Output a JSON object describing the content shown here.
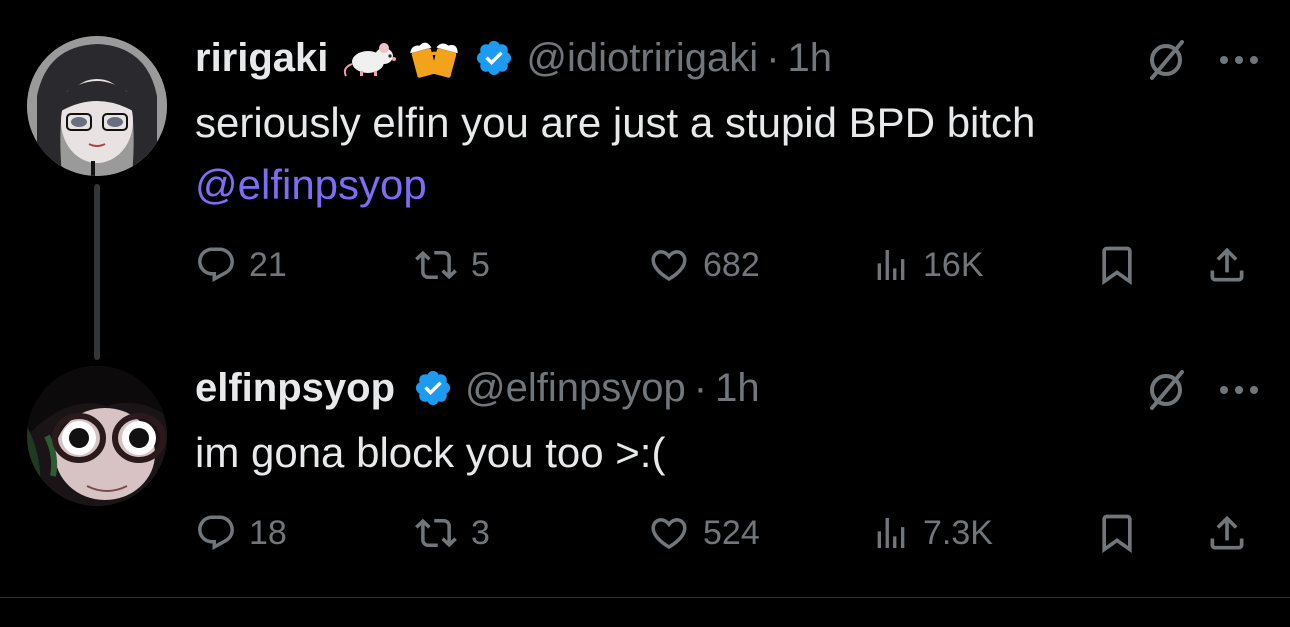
{
  "tweets": [
    {
      "display_name": "ririgaki",
      "emojis": [
        "rat-emoji",
        "beer-mugs-emoji"
      ],
      "verified": true,
      "handle": "@idiotririgaki",
      "separator": "·",
      "time": "1h",
      "text": "seriously elfin you are just a stupid BPD bitch",
      "mention": "@elfinpsyop",
      "replies": "21",
      "retweets": "5",
      "likes": "682",
      "views": "16K"
    },
    {
      "display_name": "elfinpsyop",
      "verified": true,
      "handle": "@elfinpsyop",
      "separator": "·",
      "time": "1h",
      "text": "im gona block you too >:(",
      "replies": "18",
      "retweets": "3",
      "likes": "524",
      "views": "7.3K"
    }
  ],
  "colors": {
    "background": "#000000",
    "text": "#e7e9ea",
    "muted": "#71767b",
    "mention": "#7f6cf4",
    "verified": "#1d9bf0",
    "thread_line": "#333639"
  },
  "icons": [
    "reply-icon",
    "retweet-icon",
    "like-icon",
    "views-icon",
    "bookmark-icon",
    "share-icon",
    "grok-icon",
    "more-icon",
    "verified-badge-icon"
  ]
}
